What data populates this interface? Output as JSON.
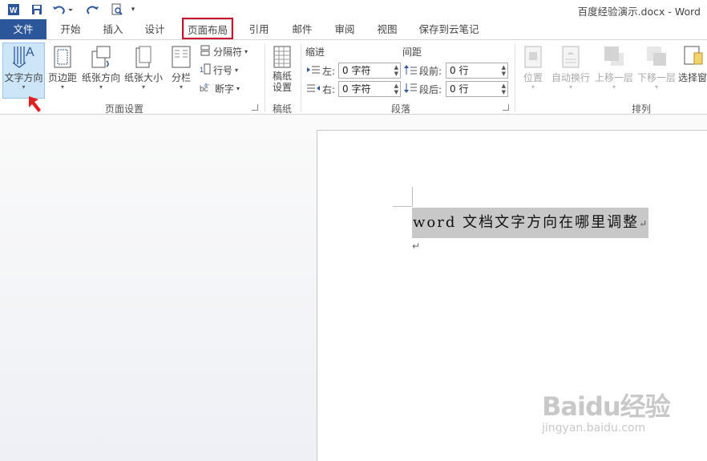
{
  "window": {
    "title": "百度经验演示.docx - Word"
  },
  "quick_access": {
    "customize_icon": "▾"
  },
  "tabs": [
    "文件",
    "开始",
    "插入",
    "设计",
    "页面布局",
    "引用",
    "邮件",
    "审阅",
    "视图",
    "保存到云笔记"
  ],
  "active_tab": "页面布局",
  "ribbon": {
    "page_setup": {
      "label": "页面设置",
      "text_direction": "文字方向",
      "margins": "页边距",
      "orientation": "纸张方向",
      "size": "纸张大小",
      "columns": "分栏",
      "breaks": "分隔符",
      "line_numbers": "行号",
      "hyphenation": "断字"
    },
    "draft_paper": {
      "label": "稿纸",
      "setup_line1": "稿纸",
      "setup_line2": "设置"
    },
    "paragraph": {
      "label": "段落",
      "indent_header": "缩进",
      "spacing_header": "间距",
      "left_label": "左:",
      "right_label": "右:",
      "before_label": "段前:",
      "after_label": "段后:",
      "left_value": "0 字符",
      "right_value": "0 字符",
      "before_value": "0 行",
      "after_value": "0 行"
    },
    "arrange": {
      "label": "排列",
      "position": "位置",
      "wrap": "自动换行",
      "forward": "上移一层",
      "backward": "下移一层",
      "selection": "选择窗"
    }
  },
  "document": {
    "selected_text": "word 文档文字方向在哪里调整",
    "para_mark": "↵"
  },
  "watermark": {
    "line1": "Baidu经验",
    "line2": "jingyan.baidu.com"
  },
  "colors": {
    "file_tab": "#2b579a",
    "highlight_box": "#c8102e",
    "selection": "#c8c8c8"
  }
}
